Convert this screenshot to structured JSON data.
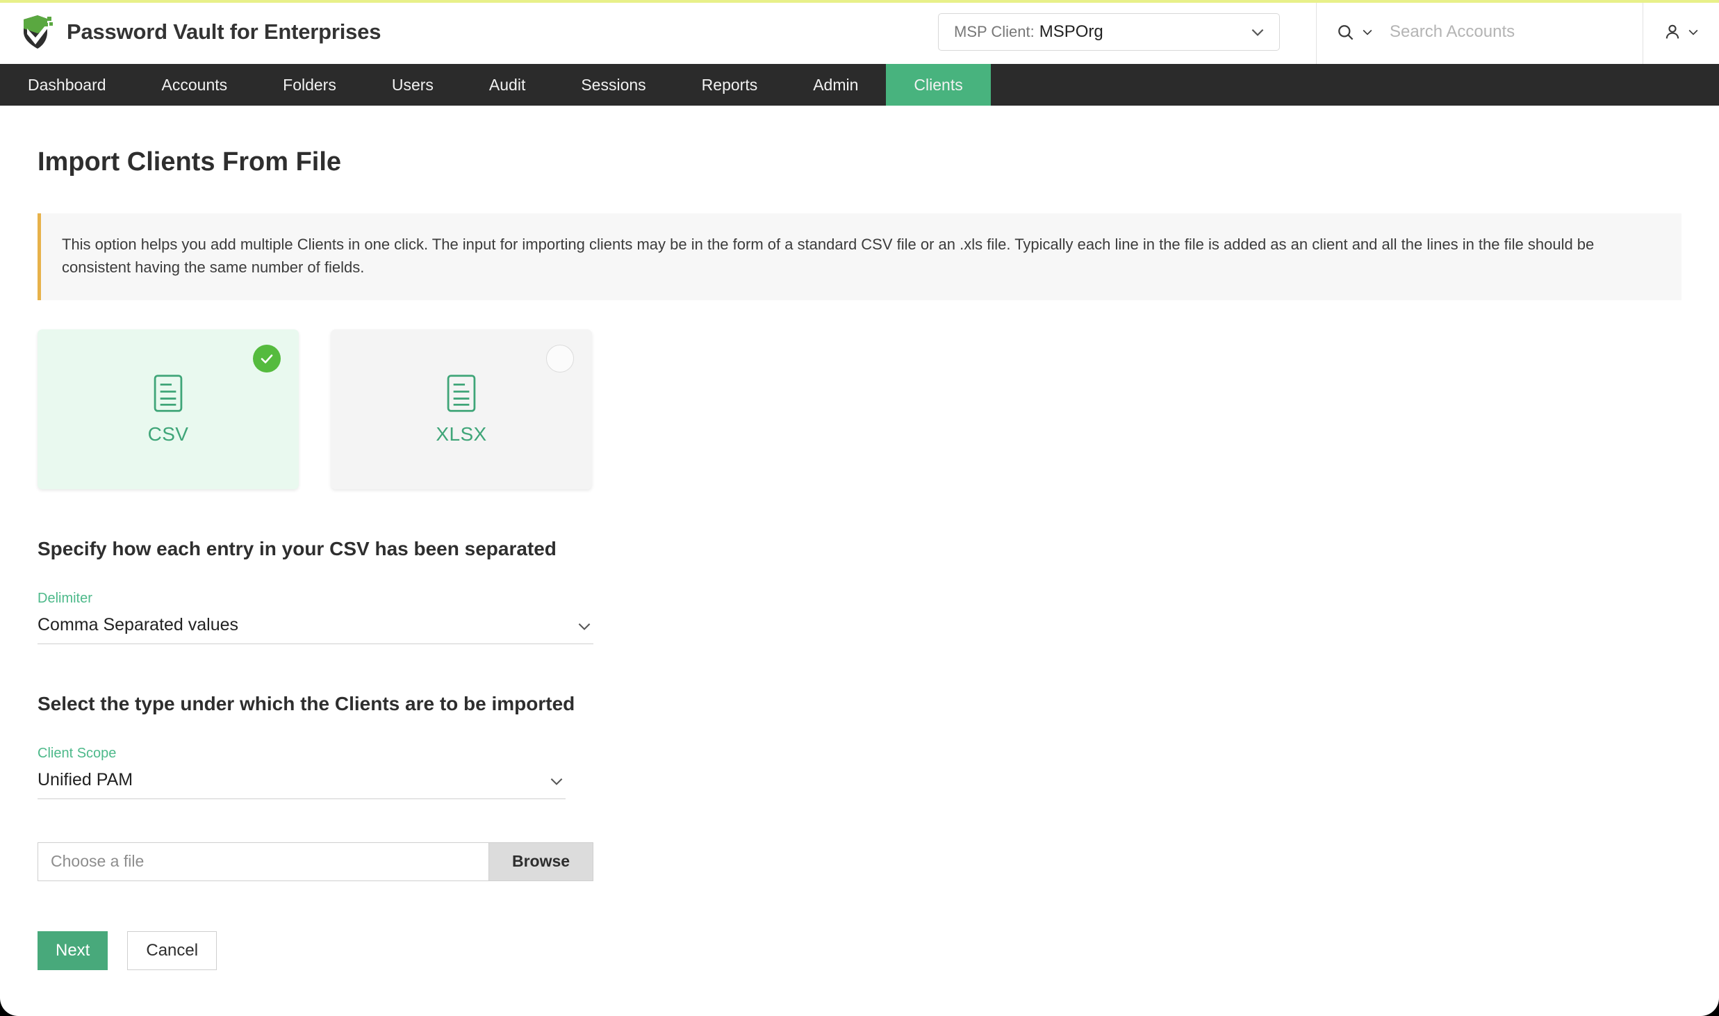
{
  "app": {
    "title": "Password Vault for Enterprises",
    "logo_icon": "shield-check-icon",
    "accent_green": "#48b37e",
    "nav_background": "#2b2b2b",
    "banner_accent": "#e7b24a"
  },
  "header": {
    "msp_selector": {
      "label": "MSP Client:",
      "value": "MSPOrg",
      "caret_icon": "chevron-down-icon"
    },
    "search": {
      "icon": "search-icon",
      "caret_icon": "chevron-down-icon",
      "placeholder": "Search Accounts",
      "value": ""
    },
    "user_menu": {
      "icon": "user-icon",
      "caret_icon": "chevron-down-icon"
    }
  },
  "nav": {
    "items": [
      {
        "label": "Dashboard",
        "active": false
      },
      {
        "label": "Accounts",
        "active": false
      },
      {
        "label": "Folders",
        "active": false
      },
      {
        "label": "Users",
        "active": false
      },
      {
        "label": "Audit",
        "active": false
      },
      {
        "label": "Sessions",
        "active": false
      },
      {
        "label": "Reports",
        "active": false
      },
      {
        "label": "Admin",
        "active": false
      },
      {
        "label": "Clients",
        "active": true
      }
    ]
  },
  "main": {
    "page_title": "Import Clients From File",
    "info_banner": "This option helps you add multiple Clients in one click. The input for importing clients may be in the form of a standard CSV file or an .xls file. Typically each line in the file is added as an client and all the lines in the file should be consistent having the same number of fields.",
    "file_types": [
      {
        "label": "CSV",
        "selected": true,
        "icon": "document-lines-icon",
        "check_icon": "check-icon"
      },
      {
        "label": "XLSX",
        "selected": false,
        "icon": "document-lines-icon",
        "check_icon": ""
      }
    ],
    "delimiter_section": {
      "heading": "Specify how each entry in your CSV has been separated",
      "field_label": "Delimiter",
      "field_value": "Comma Separated values",
      "caret_icon": "chevron-down-icon"
    },
    "scope_section": {
      "heading": "Select the type under which the Clients are to be imported",
      "field_label": "Client Scope",
      "field_value": "Unified PAM",
      "caret_icon": "chevron-down-icon"
    },
    "file_picker": {
      "placeholder": "Choose a file",
      "value": "",
      "browse_label": "Browse"
    },
    "actions": {
      "primary_label": "Next",
      "secondary_label": "Cancel"
    }
  }
}
